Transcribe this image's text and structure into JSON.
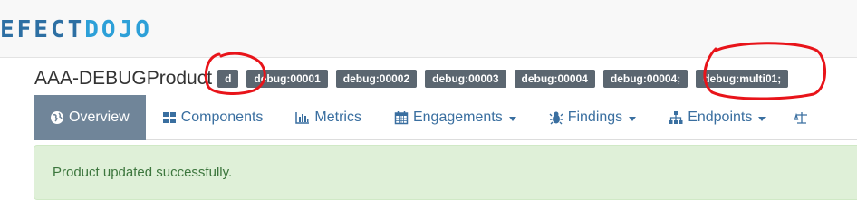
{
  "navbar": {
    "logo_part1": "EFECT",
    "logo_part2": "DOJO"
  },
  "product": {
    "name": "AAA-DEBUGProduct",
    "tags": [
      "d",
      "debug:00001",
      "debug:00002",
      "debug:00003",
      "debug:00004",
      "debug:00004;",
      "debug:multi01;"
    ]
  },
  "tabs": [
    {
      "label": "Overview",
      "icon": "globe-icon",
      "active": true,
      "dropdown": false
    },
    {
      "label": "Components",
      "icon": "th-large-icon",
      "active": false,
      "dropdown": false
    },
    {
      "label": "Metrics",
      "icon": "bar-chart-icon",
      "active": false,
      "dropdown": false
    },
    {
      "label": "Engagements",
      "icon": "calendar-icon",
      "active": false,
      "dropdown": true
    },
    {
      "label": "Findings",
      "icon": "bug-icon",
      "active": false,
      "dropdown": true
    },
    {
      "label": "Endpoints",
      "icon": "sitemap-icon",
      "active": false,
      "dropdown": true
    }
  ],
  "alert": {
    "message": "Product updated successfully."
  },
  "colors": {
    "active_tab": "#708599",
    "link": "#3a6fa0",
    "tag_bg": "#5b6670",
    "alert_bg": "#dff0d8",
    "alert_text": "#3c763d",
    "annotation": "#e8141a"
  }
}
